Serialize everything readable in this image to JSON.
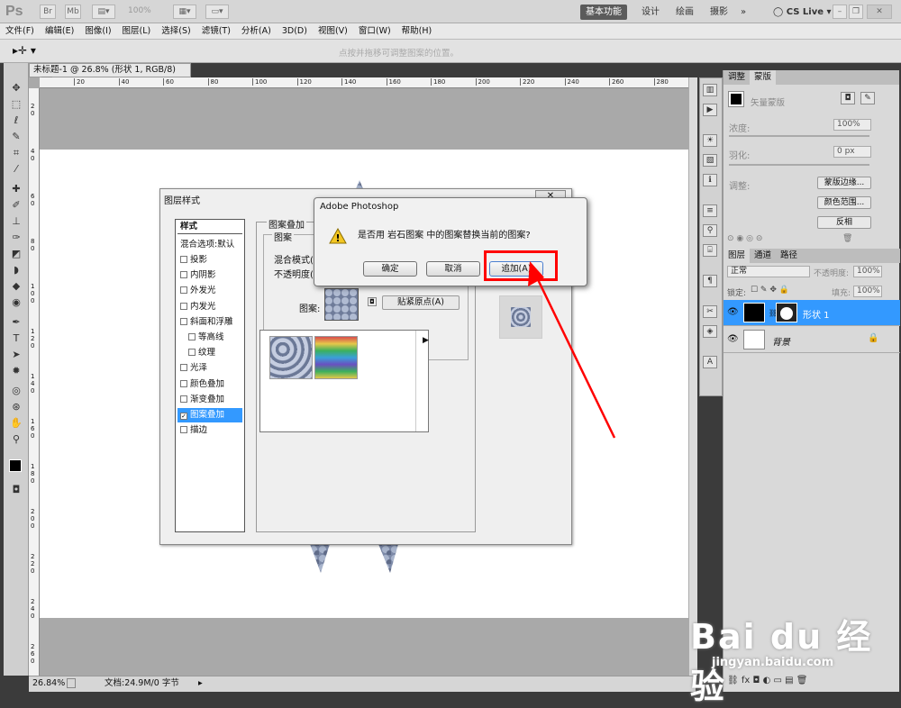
{
  "app": {
    "logo": "Ps",
    "zoom_select": "100%",
    "workspaces": [
      "基本功能",
      "设计",
      "绘画",
      "摄影"
    ],
    "more": "»",
    "cslive": "CS Live"
  },
  "menu": [
    "文件(F)",
    "编辑(E)",
    "图像(I)",
    "图层(L)",
    "选择(S)",
    "滤镜(T)",
    "分析(A)",
    "3D(D)",
    "视图(V)",
    "窗口(W)",
    "帮助(H)"
  ],
  "options": {
    "hint": "点按并拖移可调整图案的位置。"
  },
  "document": {
    "tab_title": "未标题-1 @ 26.8% (形状 1, RGB/8) *",
    "close": "×",
    "ruler_h": [
      "20",
      "40",
      "60",
      "80",
      "100",
      "120",
      "140",
      "160",
      "180",
      "200",
      "220",
      "240",
      "260",
      "280"
    ],
    "ruler_v": [
      "2\n0",
      "4\n0",
      "6\n0",
      "8\n0",
      "1\n0\n0",
      "1\n2\n0",
      "1\n4\n0",
      "1\n6\n0",
      "1\n8\n0",
      "2\n0\n0",
      "2\n2\n0",
      "2\n4\n0",
      "2\n6\n0"
    ]
  },
  "status": {
    "zoom": "26.84%",
    "doc": "文档:24.9M/0 字节"
  },
  "adjust_panel": {
    "tabs": [
      "调整",
      "蒙版"
    ],
    "mask_label": "矢量蒙版",
    "density_label": "浓度:",
    "density": "100%",
    "feather_label": "羽化:",
    "feather": "0 px",
    "refine_label": "调整:",
    "btn_mask_edge": "蒙版边缘...",
    "btn_color_range": "颜色范围...",
    "btn_invert": "反相"
  },
  "layers_panel": {
    "tabs": [
      "图层",
      "通道",
      "路径"
    ],
    "blend": "正常",
    "opacity_label": "不透明度:",
    "opacity": "100%",
    "lock_label": "锁定:",
    "fill_label": "填充:",
    "fill": "100%",
    "layers": [
      {
        "name": "形状 1",
        "selected": true
      },
      {
        "name": "背景",
        "selected": false
      }
    ]
  },
  "layer_style": {
    "title": "图层样式",
    "list_header": "样式",
    "blend_default": "混合选项:默认",
    "items": [
      {
        "label": "投影",
        "checked": false
      },
      {
        "label": "内阴影",
        "checked": false
      },
      {
        "label": "外发光",
        "checked": false
      },
      {
        "label": "内发光",
        "checked": false
      },
      {
        "label": "斜面和浮雕",
        "checked": false
      },
      {
        "label": "等高线",
        "checked": false,
        "indent": true
      },
      {
        "label": "纹理",
        "checked": false,
        "indent": true
      },
      {
        "label": "光泽",
        "checked": false
      },
      {
        "label": "颜色叠加",
        "checked": false
      },
      {
        "label": "渐变叠加",
        "checked": false
      },
      {
        "label": "图案叠加",
        "checked": true,
        "selected": true
      },
      {
        "label": "描边",
        "checked": false
      }
    ],
    "group_title": "图案叠加",
    "sub_group": "图案",
    "blend_mode_label": "混合模式(B)",
    "opacity_label": "不透明度(Y)",
    "pattern_label": "图案:",
    "snap_button": "贴紧原点(A)"
  },
  "alert": {
    "title": "Adobe Photoshop",
    "message": "是否用 岩石图案 中的图案替换当前的图案?",
    "ok": "确定",
    "cancel": "取消",
    "append": "追加(A)"
  },
  "colors": {
    "highlight": "#3399ff",
    "annotation": "#ff0000",
    "canvas": "#ffffff"
  },
  "watermark": {
    "brand": "Bai du 经验",
    "url": "jingyan.baidu.com"
  }
}
